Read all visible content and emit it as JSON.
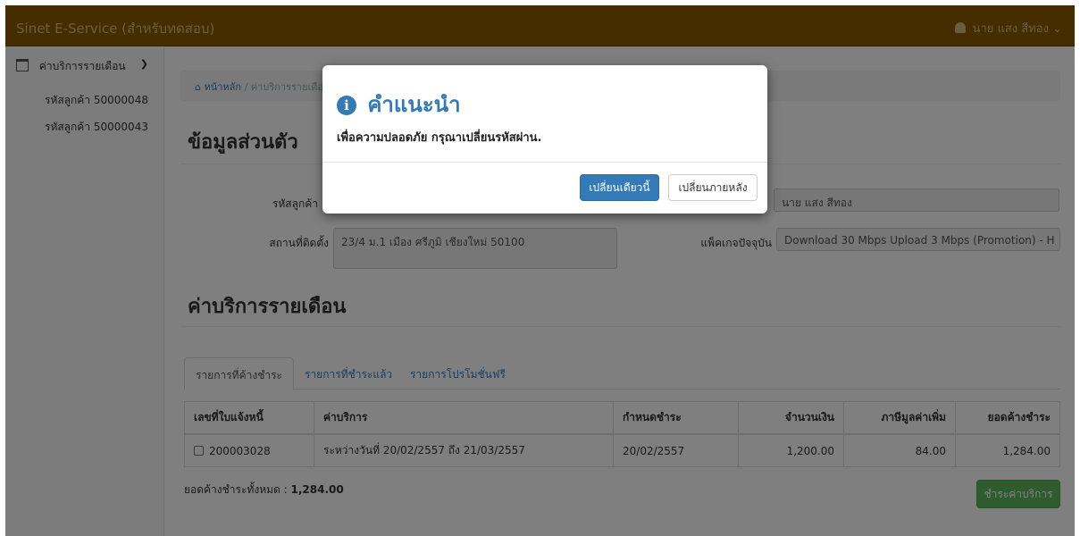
{
  "header": {
    "brand": "Sinet E-Service (สำหรับทดสอบ)",
    "user_name": "นาย แสง สีทอง",
    "user_caret": "⌄"
  },
  "sidebar": {
    "section_label": "ค่าบริการรายเดือน",
    "items": [
      {
        "label": "รหัสลูกค้า 50000048"
      },
      {
        "label": "รหัสลูกค้า 50000043"
      }
    ]
  },
  "breadcrumb": {
    "home": "หน้าหลัก",
    "separator": "/",
    "current": "ค่าบริการรายเดือน"
  },
  "personal": {
    "heading": "ข้อมูลส่วนตัว",
    "customer_id_label": "รหัสลูกค้า",
    "name_value": "นาย แสง สีทอง",
    "address_label": "สถานที่ติดตั้ง",
    "address_value": "23/4 ม.1 เมือง ศรีภูมิ เชียงใหม่ 50100",
    "package_label": "แพ็คเกจปัจจุบัน",
    "package_value": "Download 30 Mbps Upload 3 Mbps (Promotion) - H"
  },
  "monthly": {
    "heading": "ค่าบริการรายเดือน",
    "tabs": [
      {
        "label": "รายการที่ค้างชำระ"
      },
      {
        "label": "รายการที่ชำระแล้ว"
      },
      {
        "label": "รายการโปรโมชั่นฟรี"
      }
    ],
    "columns": [
      "เลขที่ใบแจ้งหนี้",
      "ค่าบริการ",
      "กำหนดชำระ",
      "จำนวนเงิน",
      "ภาษีมูลค่าเพิ่ม",
      "ยอดค้างชำระ"
    ],
    "rows": [
      {
        "invoice": "200003028",
        "service": "ระหว่างวันที่ 20/02/2557 ถึง 21/03/2557",
        "due": "20/02/2557",
        "amount": "1,200.00",
        "vat": "84.00",
        "balance": "1,284.00"
      }
    ],
    "total_label": "ยอดค้างชำระทั้งหมด :",
    "total_value": "1,284.00",
    "pay_button": "ชำระค่าบริการ"
  },
  "modal": {
    "icon": "i",
    "title": "คำแนะนำ",
    "message": "เพื่อความปลอดภัย กรุณาเปลี่ยนรหัสผ่าน.",
    "primary_button": "เปลี่ยนเดียวนี้",
    "secondary_button": "เปลี่ยนภายหลัง"
  },
  "colors": {
    "topbar": "#8a5a00",
    "primary": "#337ab7",
    "success": "#5cb85c"
  }
}
